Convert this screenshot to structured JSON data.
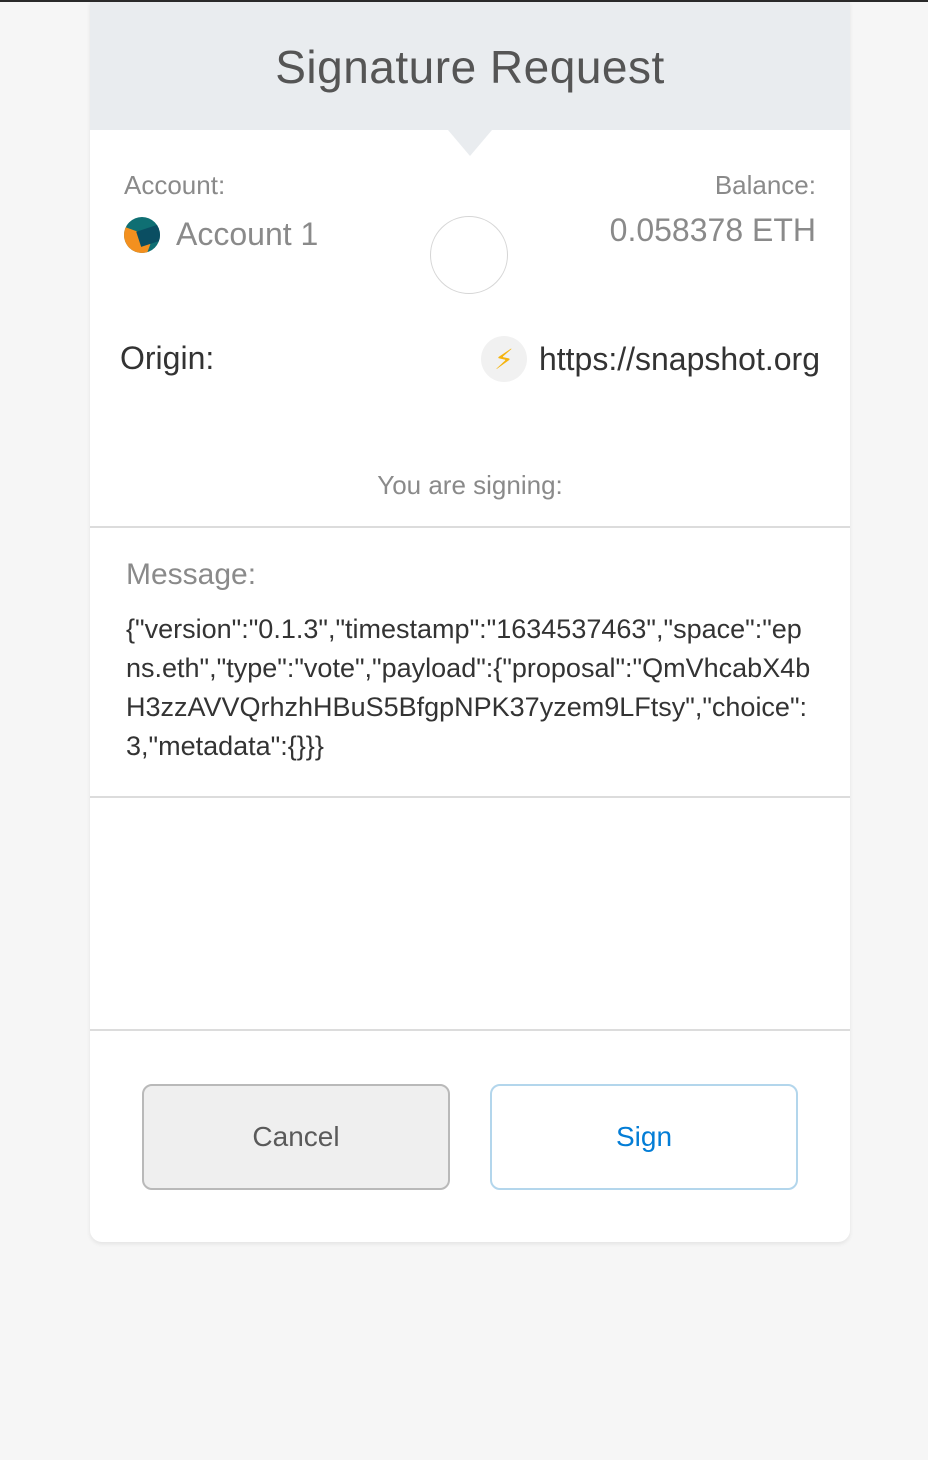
{
  "header": {
    "title": "Signature Request"
  },
  "account": {
    "label": "Account:",
    "name": "Account 1",
    "avatar_icon": "account-identicon-icon"
  },
  "balance": {
    "label": "Balance:",
    "value": "0.058378 ETH"
  },
  "origin": {
    "label": "Origin:",
    "url": "https://snapshot.org",
    "icon": "lightning-bolt-icon",
    "icon_glyph": "⚡"
  },
  "signing_label": "You are signing:",
  "message": {
    "label": "Message:",
    "body": "{\"version\":\"0.1.3\",\"timestamp\":\"1634537463\",\"space\":\"epns.eth\",\"type\":\"vote\",\"payload\":{\"proposal\":\"QmVhcabX4bH3zzAVVQrhzhHBuS5BfgpNPK37yzem9LFtsy\",\"choice\":3,\"metadata\":{}}}"
  },
  "buttons": {
    "cancel": "Cancel",
    "sign": "Sign"
  },
  "colors": {
    "header_bg": "#e9ecef",
    "sign_text": "#037dd6",
    "sign_border": "#b3d6ec",
    "bolt": "#f5b40f"
  }
}
